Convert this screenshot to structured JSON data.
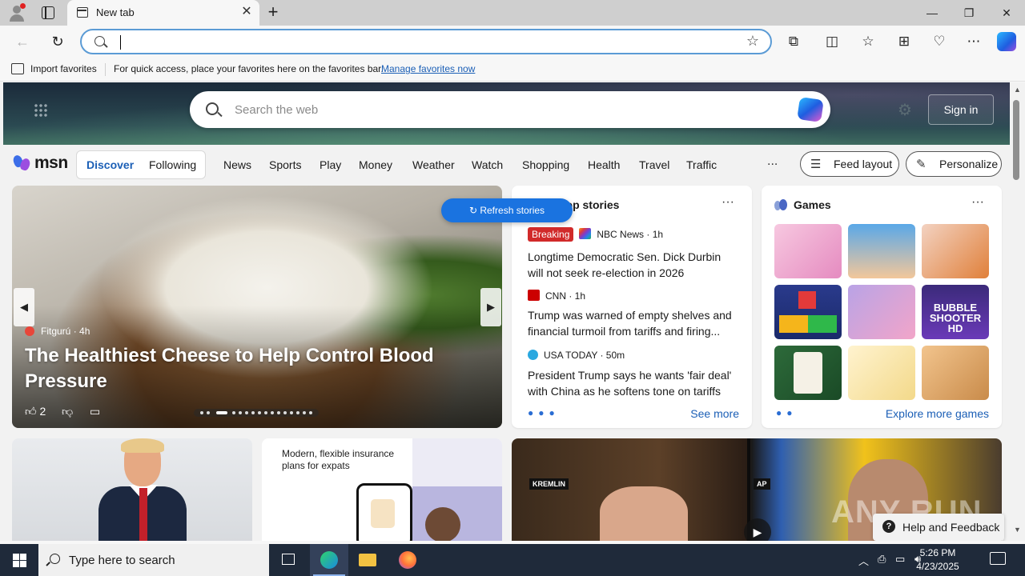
{
  "browser": {
    "tab_title": "New tab",
    "address_value": "",
    "favorites_bar": {
      "import_label": "Import favorites",
      "hint": "For quick access, place your favorites here on the favorites bar.",
      "manage_link": "Manage favorites now"
    }
  },
  "msn": {
    "search_placeholder": "Search the web",
    "sign_in": "Sign in",
    "logo": "msn",
    "segment": {
      "discover": "Discover",
      "following": "Following"
    },
    "nav": [
      "News",
      "Sports",
      "Play",
      "Money",
      "Weather",
      "Watch",
      "Shopping",
      "Health",
      "Travel",
      "Traffic"
    ],
    "more": "...",
    "feed_layout": "Feed layout",
    "personalize": "Personalize",
    "refresh_stories": "Refresh stories"
  },
  "hero": {
    "source": "Fitgurú",
    "age": "4h",
    "headline": "The Healthiest Cheese to Help Control Blood Pressure",
    "likes": "2"
  },
  "stories": {
    "header": "Top stories",
    "items": [
      {
        "badge": "Breaking",
        "source": "NBC News · 1h",
        "title": "Longtime Democratic Sen. Dick Durbin will not seek re-election in 2026"
      },
      {
        "source": "CNN · 1h",
        "title": "Trump was warned of empty shelves and financial turmoil from tariffs and firing..."
      },
      {
        "source": "USA TODAY · 50m",
        "title": "President Trump says he wants 'fair deal' with China as he softens tone on tariffs"
      }
    ],
    "see_more": "See more"
  },
  "games": {
    "header": "Games",
    "explore": "Explore more games",
    "bubble_tile": "BUBBLE SHOOTER HD"
  },
  "bottom": {
    "ad_text": "Modern, flexible insurance plans for expats",
    "tag_left": "KREMLIN",
    "tag_right": "AP"
  },
  "help_feedback": "Help and Feedback",
  "watermark": "ANY RUN",
  "taskbar": {
    "search_placeholder": "Type here to search",
    "time": "5:26 PM",
    "date": "4/23/2025"
  }
}
